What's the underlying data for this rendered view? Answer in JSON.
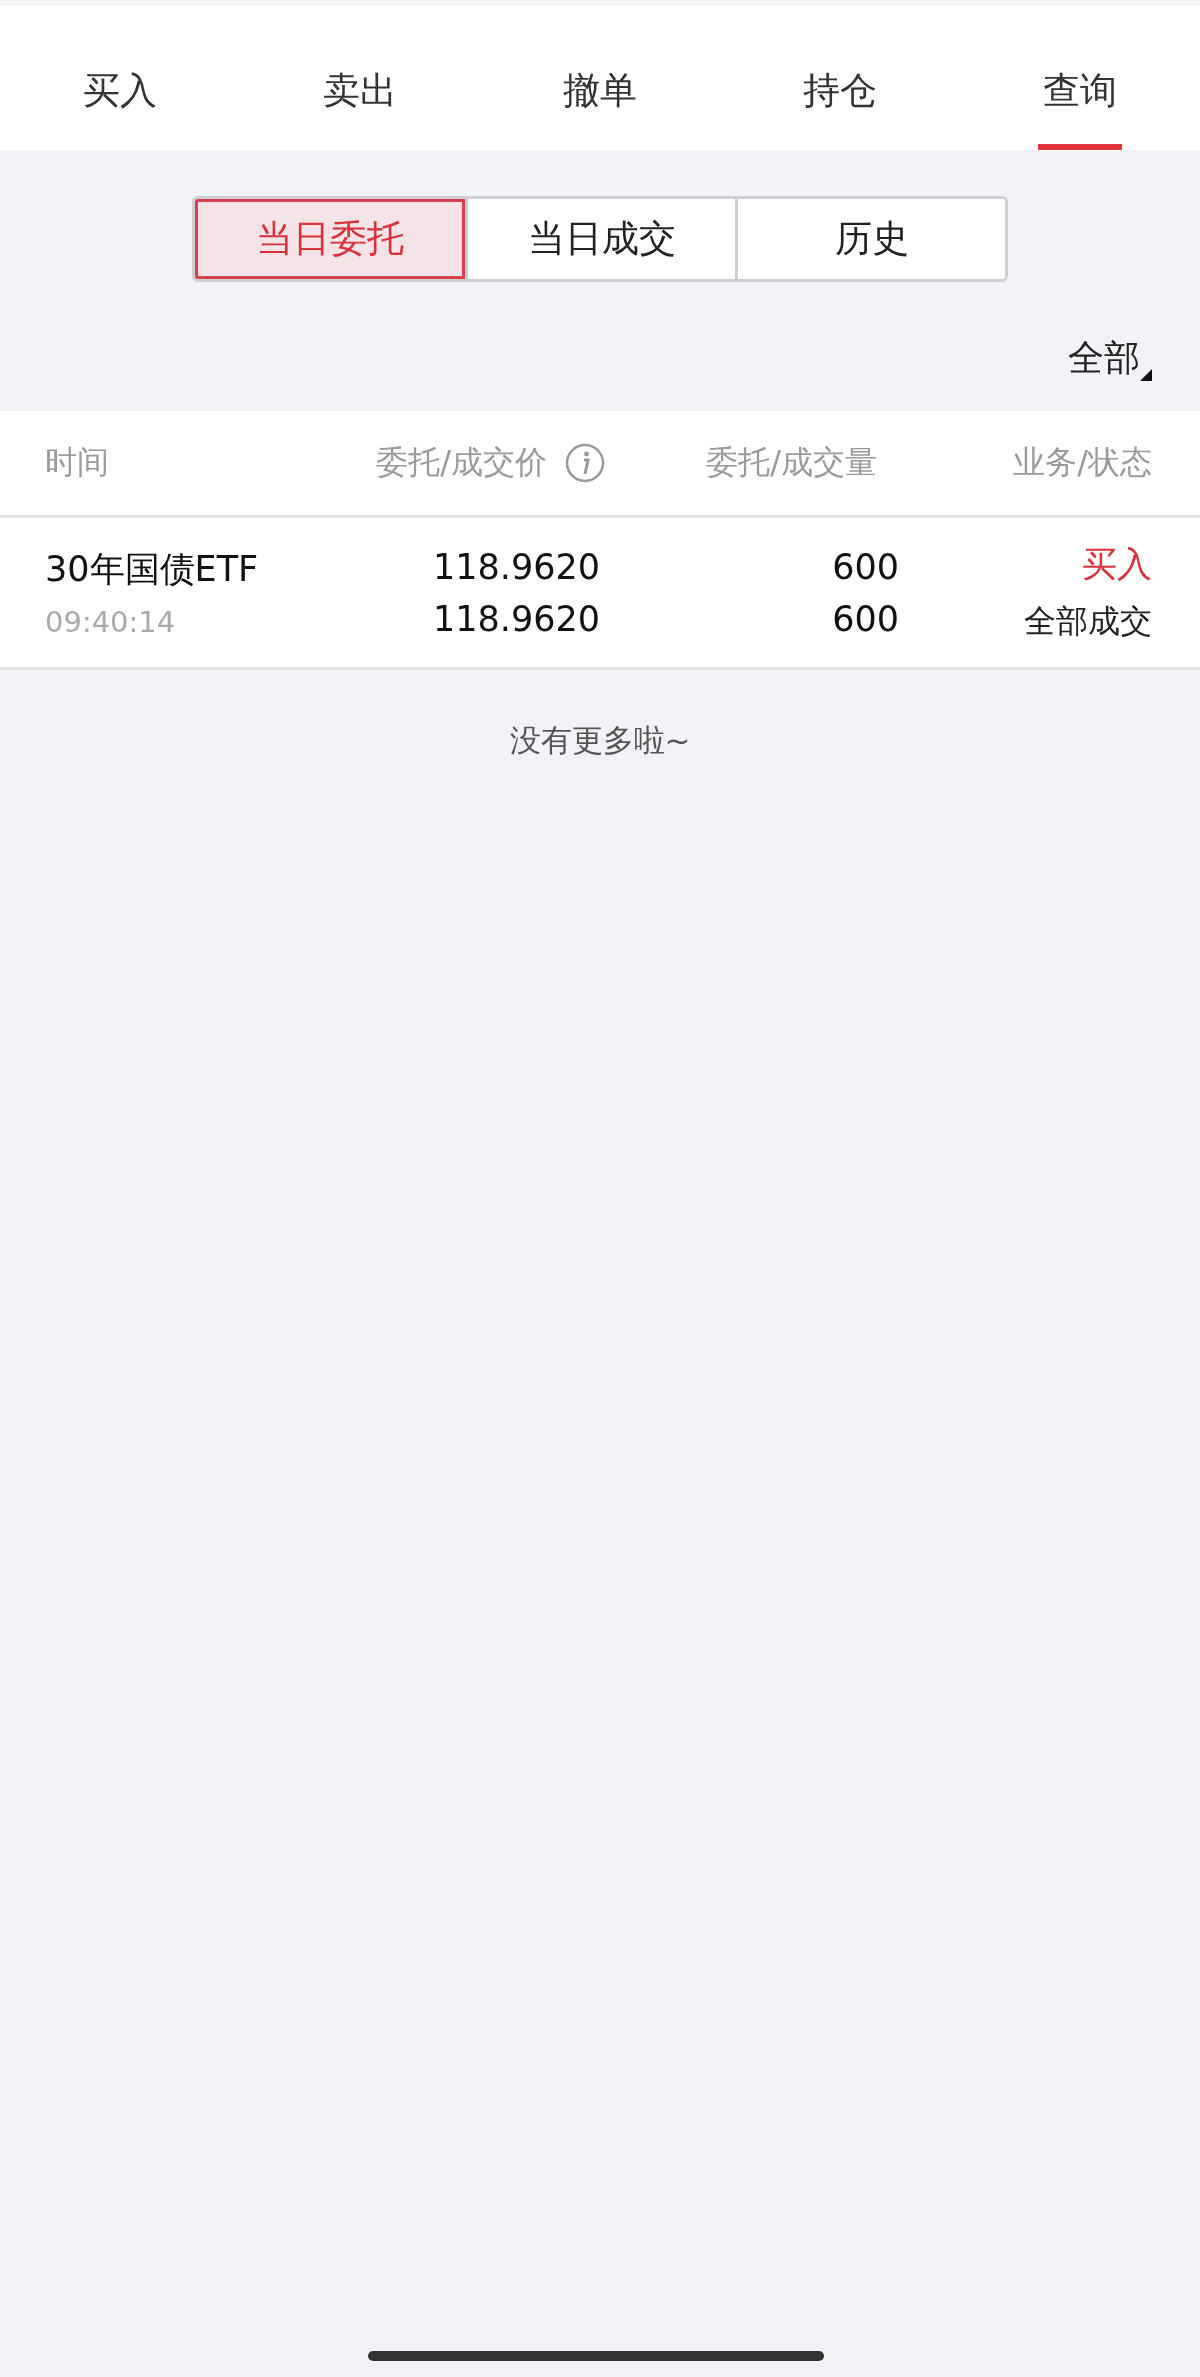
{
  "tabs": [
    {
      "label": "买入",
      "selected": false
    },
    {
      "label": "卖出",
      "selected": false
    },
    {
      "label": "撤单",
      "selected": false
    },
    {
      "label": "持仓",
      "selected": false
    },
    {
      "label": "查询",
      "selected": true
    }
  ],
  "segments": [
    {
      "label": "当日委托",
      "selected": true
    },
    {
      "label": "当日成交",
      "selected": false
    },
    {
      "label": "历史",
      "selected": false
    }
  ],
  "filter": {
    "label": "全部"
  },
  "table": {
    "columns": [
      "时间",
      "委托/成交价",
      "委托/成交量",
      "业务/状态"
    ],
    "rows": [
      {
        "name": "30年国债ETF",
        "time": "09:40:14",
        "order_price": "118.9620",
        "deal_price": "118.9620",
        "order_qty": "600",
        "deal_qty": "600",
        "side": {
          "label": "买入",
          "kind": "buy"
        },
        "status": "全部成交"
      }
    ]
  },
  "footer": "没有更多啦~"
}
